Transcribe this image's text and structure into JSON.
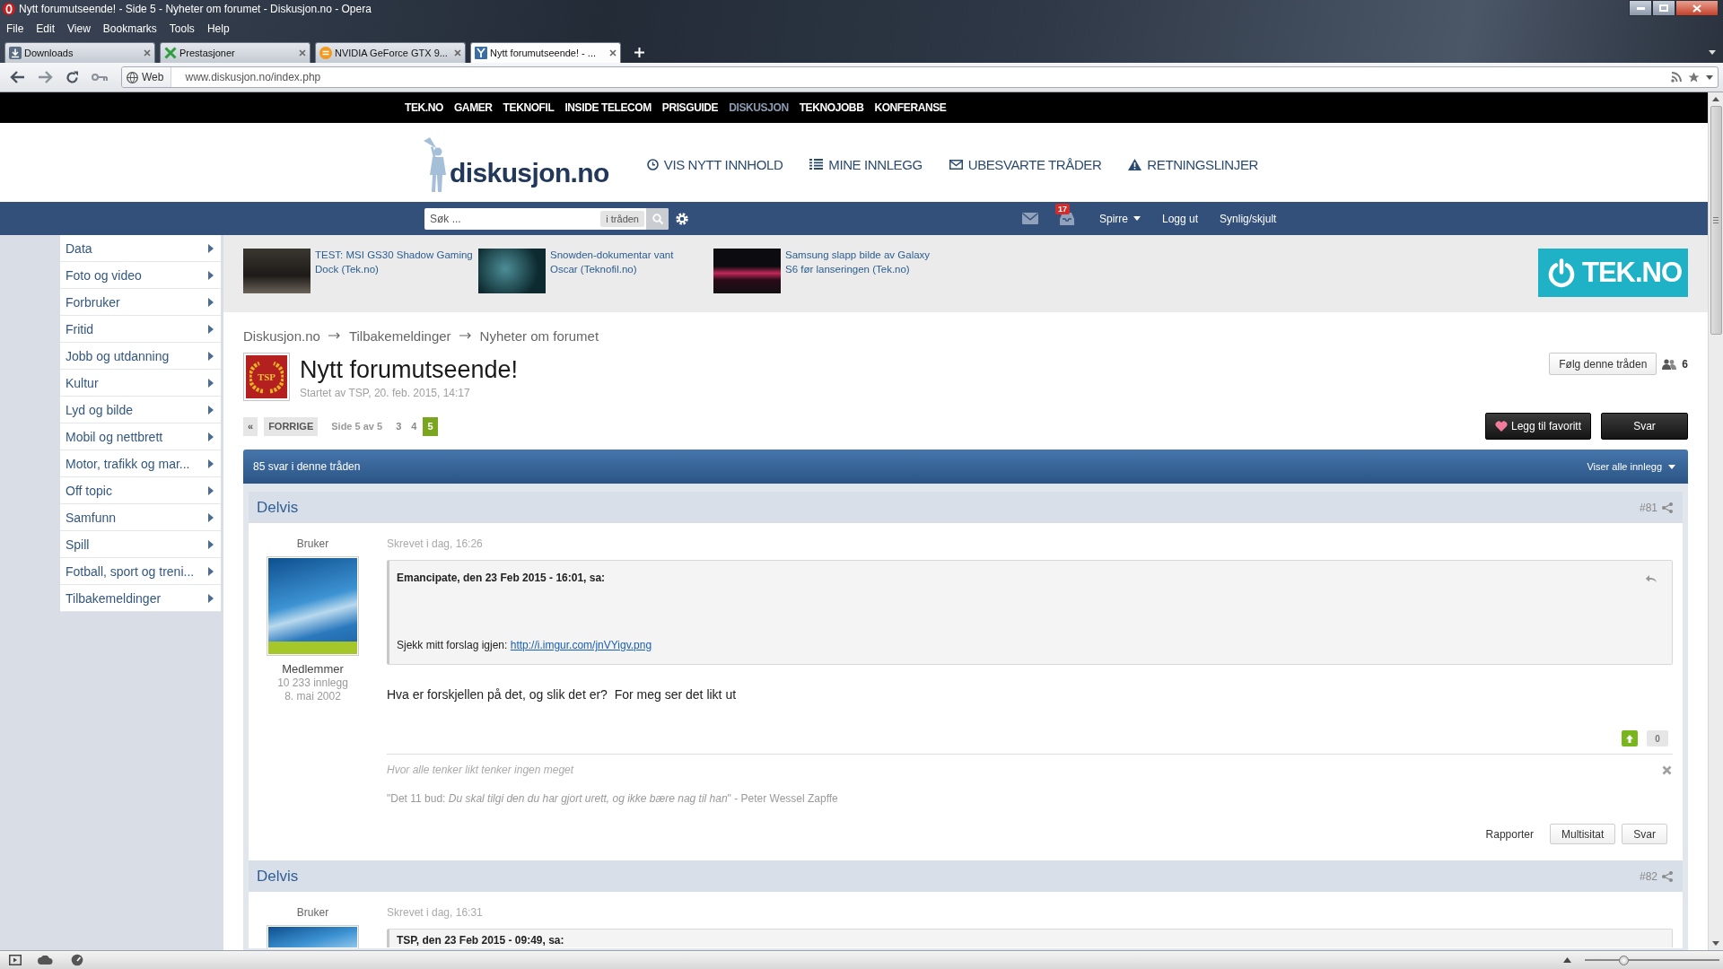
{
  "window": {
    "title": "Nytt forumutseende! - Side 5 - Nyheter om forumet - Diskusjon.no - Opera"
  },
  "menu_bar": [
    "File",
    "Edit",
    "View",
    "Bookmarks",
    "Tools",
    "Help"
  ],
  "tabs": [
    {
      "label": "Downloads",
      "selected": false
    },
    {
      "label": "Prestasjoner",
      "selected": false
    },
    {
      "label": "NVIDIA GeForce GTX 9...",
      "selected": false
    },
    {
      "label": "Nytt forumutseende! - ...",
      "selected": true
    }
  ],
  "address_bar": {
    "badge": "Web",
    "url": "www.diskusjon.no/index.php"
  },
  "site_nav": [
    {
      "label": "TEK.NO",
      "selected": false
    },
    {
      "label": "GAMER",
      "selected": false
    },
    {
      "label": "TEKNOFIL",
      "selected": false
    },
    {
      "label": "INSIDE TELECOM",
      "selected": false
    },
    {
      "label": "PRISGUIDE",
      "selected": false
    },
    {
      "label": "DISKUSJON",
      "selected": true
    },
    {
      "label": "TEKNOJOBB",
      "selected": false
    },
    {
      "label": "KONFERANSE",
      "selected": false
    }
  ],
  "header": {
    "logo": "diskusjon.no",
    "links": [
      "VIS NYTT INNHOLD",
      "MINE INNLEGG",
      "UBESVARTE TRÅDER",
      "RETNINGSLINJER"
    ]
  },
  "user_bar": {
    "search": {
      "placeholder": "Søk ...",
      "scope": "i tråden"
    },
    "notifications": "17",
    "user": "Spirre",
    "links": [
      "Logg ut",
      "Synlig/skjult"
    ]
  },
  "sidebar": {
    "items": [
      "Data",
      "Foto og video",
      "Forbruker",
      "Fritid",
      "Jobb og utdanning",
      "Kultur",
      "Lyd og bilde",
      "Mobil og nettbrett",
      "Motor, trafikk og mar...",
      "Off topic",
      "Samfunn",
      "Spill",
      "Fotball, sport og treni...",
      "Tilbakemeldinger"
    ]
  },
  "news": [
    {
      "title": "TEST: MSI GS30 Shadow Gaming Dock (Tek.no)"
    },
    {
      "title": "Snowden-dokumentar vant Oscar (Teknofil.no)"
    },
    {
      "title": "Samsung slapp bilde av Galaxy S6 før lanseringen (Tek.no)"
    }
  ],
  "brand_logo": "TEK.NO",
  "breadcrumb": [
    "Diskusjon.no",
    "Tilbakemeldinger",
    "Nyheter om forumet"
  ],
  "thread": {
    "avatar_label": "TSP",
    "title": "Nytt forumutseende!",
    "meta": "Startet av TSP, 20. feb. 2015, 14:17",
    "follow_button": "Følg denne tråden",
    "followers": "6"
  },
  "pagination": {
    "first": "«",
    "previous": "FORRIGE",
    "info": "Side 5 av 5",
    "pages": [
      {
        "label": "3",
        "selected": false
      },
      {
        "label": "4",
        "selected": false
      },
      {
        "label": "5",
        "selected": true
      }
    ]
  },
  "thread_actions": [
    "Legg til favoritt",
    "Svar"
  ],
  "thread_bar": {
    "count": "85 svar i denne tråden",
    "filter": "Viser alle innlegg"
  },
  "posts": [
    {
      "author": "Delvis",
      "number": "#81",
      "role": "Bruker",
      "group": "Medlemmer",
      "post_count": "10 233 innlegg",
      "joined": "8. mai 2002",
      "time": "Skrevet i dag, 16:26",
      "quote": {
        "header": "Emancipate, den 23 Feb 2015 - 16:01, sa:",
        "text": "Sjekk mitt forslag igjen:",
        "link": "http://i.imgur.com/jnVYigv.png"
      },
      "body": "Hva er forskjellen på det, og slik det er?  For meg ser det likt ut",
      "votes": "0",
      "signature": {
        "motto": "Hvor alle tenker likt tenker ingen meget",
        "quote": "\"Det 11 bud: *Du skal tilgi den du har gjort urett, og ikke bære nag til han*\" - Peter Wessel Zapffe"
      },
      "report": "Rapporter",
      "buttons": [
        "Multisitat",
        "Svar"
      ]
    },
    {
      "author": "Delvis",
      "number": "#82",
      "role": "Bruker",
      "time": "Skrevet i dag, 16:31",
      "quote": {
        "header": "TSP, den 23 Feb 2015 - 09:49, sa:"
      }
    }
  ],
  "status_bar": {
    "zoom": {
      "level": 0.27
    }
  }
}
